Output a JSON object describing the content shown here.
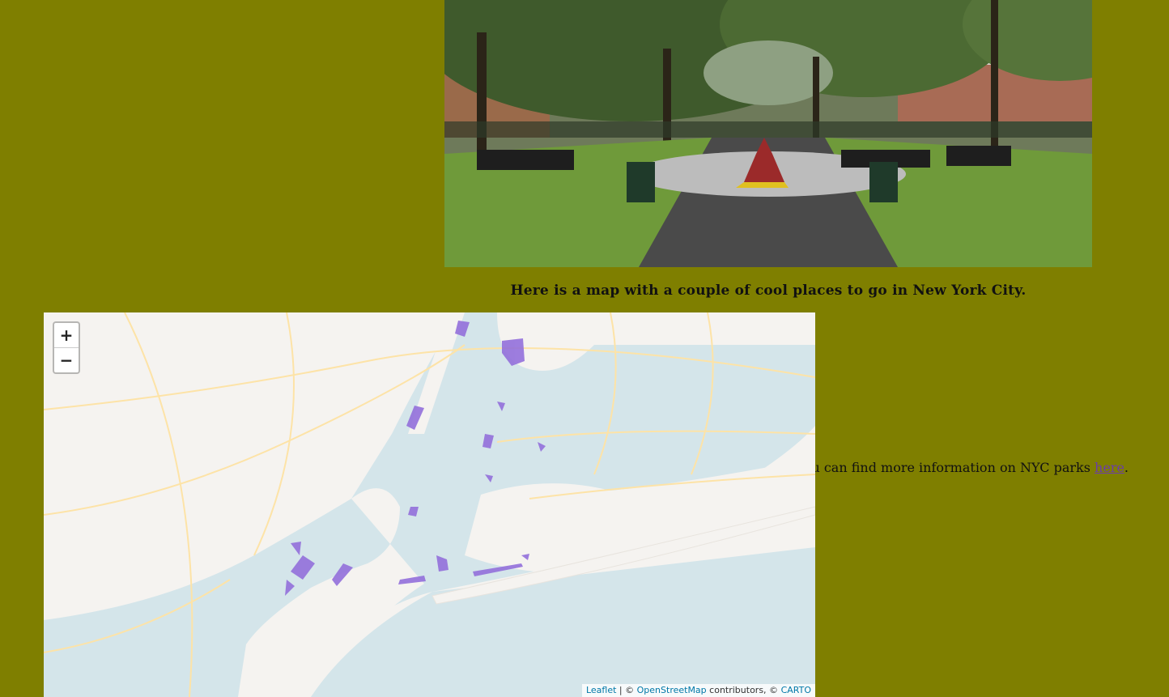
{
  "photo": {
    "description_icon": "park-photo"
  },
  "caption": "Here is a map with a couple of cool places to go in New York City.",
  "info": {
    "prefix": "u can find more information on NYC parks ",
    "link_text": "here",
    "suffix": "."
  },
  "map": {
    "zoom_in": "+",
    "zoom_out": "−",
    "attribution": {
      "leaflet": "Leaflet",
      "sep": " | © ",
      "osm": "OpenStreetMap",
      "mid": " contributors, © ",
      "carto": "CARTO"
    },
    "colors": {
      "water": "#d4e5ea",
      "land": "#f5f3f0",
      "park": "#9370db",
      "road": "#fde3a7"
    }
  }
}
